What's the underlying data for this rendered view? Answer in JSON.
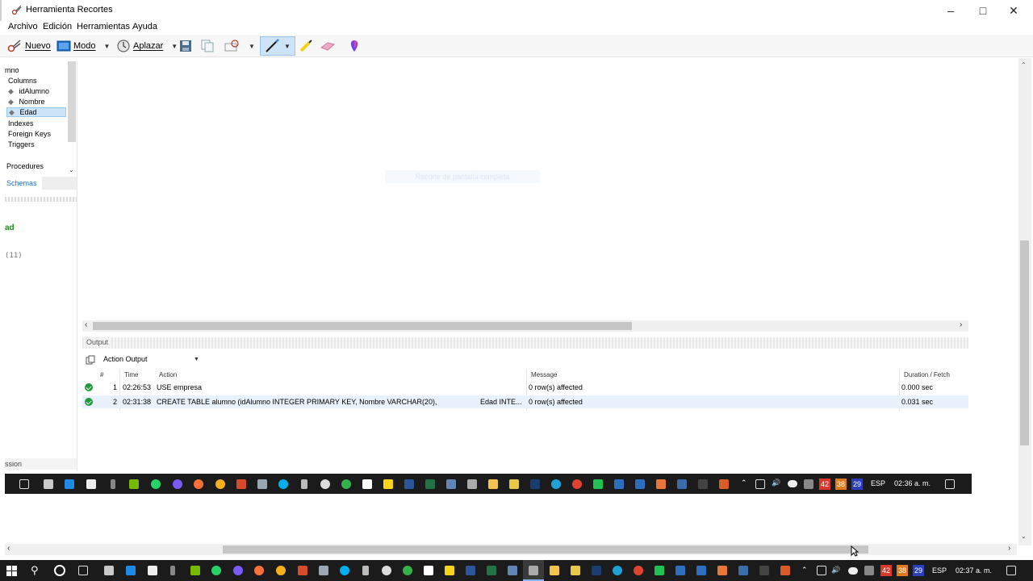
{
  "window": {
    "title": "Herramienta Recortes"
  },
  "menu": [
    "Archivo",
    "Edición",
    "Herramientas",
    "Ayuda"
  ],
  "toolbar": {
    "nuevo": "Nuevo",
    "modo": "Modo",
    "aplazar": "Aplazar"
  },
  "tree": {
    "table_tail": "mno",
    "columns_label": "Columns",
    "columns": [
      "idAlumno",
      "Nombre",
      "Edad"
    ],
    "selected_column": "Edad",
    "indexes": "Indexes",
    "foreign_keys": "Foreign Keys",
    "triggers": "Triggers",
    "procedures": "Procedures",
    "schemas_tab": "Schemas",
    "info_name": "ad",
    "info_type": "(11)",
    "session": "ssion"
  },
  "editor": {
    "watermark": "Recorte de pantalla completa"
  },
  "output": {
    "title": "Output",
    "selector": "Action Output",
    "headers": {
      "num": "#",
      "time": "Time",
      "action": "Action",
      "message": "Message",
      "duration": "Duration / Fetch"
    },
    "rows": [
      {
        "num": "1",
        "time": "02:26:53",
        "action": "USE empresa",
        "action_tail": "",
        "message": "0 row(s) affected",
        "duration": "0.000 sec"
      },
      {
        "num": "2",
        "time": "02:31:38",
        "action": "CREATE TABLE alumno (idAlumno INTEGER PRIMARY KEY,  Nombre VARCHAR(20),",
        "action_tail": "Edad INTE...",
        "message": "0 row(s) affected",
        "duration": "0.031 sec"
      }
    ]
  },
  "inner_taskbar": {
    "lang": "ESP",
    "time": "02:36 a. m.",
    "badges": [
      "42",
      "38",
      "29"
    ]
  },
  "taskbar": {
    "lang": "ESP",
    "time": "02:37 a. m.",
    "badges": [
      "42",
      "38",
      "29"
    ]
  },
  "colors": {
    "accent": "#0078d7",
    "ok": "#1e9b3b",
    "selection": "#cce4f7",
    "taskbar": "#1b1b1b"
  }
}
